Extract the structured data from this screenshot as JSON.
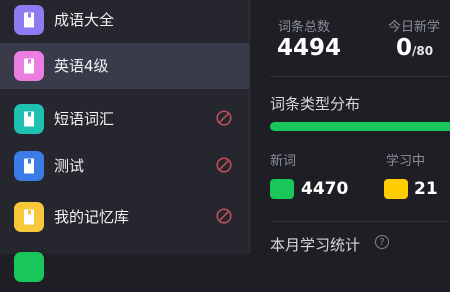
{
  "colors": {
    "purple": "#8d7cf2",
    "pink": "#ec7ee2",
    "teal": "#1ec0b0",
    "blue": "#3a7be6",
    "yellow": "#f7c93a",
    "ban": "#c2505a",
    "green": "#18c65a",
    "gold": "#ffcc00"
  },
  "sidebar": {
    "items": [
      {
        "label": "成语大全",
        "icon": "book-icon",
        "active": false,
        "disabled": false
      },
      {
        "label": "英语4级",
        "icon": "book-icon",
        "active": true,
        "disabled": false
      },
      {
        "label": "短语词汇",
        "icon": "book-icon",
        "active": false,
        "disabled": true
      },
      {
        "label": "测试",
        "icon": "book-icon",
        "active": false,
        "disabled": true
      },
      {
        "label": "我的记忆库",
        "icon": "book-icon",
        "active": false,
        "disabled": true
      }
    ]
  },
  "stats": {
    "total_label": "词条总数",
    "total_value": "4494",
    "today_label": "今日新学",
    "today_value": "0",
    "today_limit": "/80"
  },
  "distribution": {
    "title": "词条类型分布",
    "new_label": "新词",
    "new_count": "4470",
    "learning_label": "学习中",
    "learning_count": "21",
    "fill_fraction": 0.995
  },
  "monthly": {
    "title": "本月学习统计",
    "help_glyph": "?"
  }
}
